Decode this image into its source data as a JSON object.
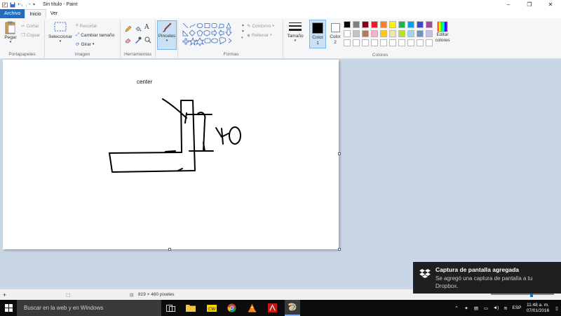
{
  "window": {
    "title": "Sin título - Paint",
    "controls": [
      "–",
      "❐",
      "✕"
    ]
  },
  "tabs": [
    "Archivo",
    "Inicio",
    "Ver"
  ],
  "ribbon": {
    "clipboard": {
      "paste": "Pegar",
      "cut": "Cortar",
      "copy": "Copiar",
      "label": "Portapapeles"
    },
    "image": {
      "select": "Seleccionar",
      "crop": "Recortar",
      "resize": "Cambiar tamaño",
      "rotate": "Girar",
      "label": "Imagen"
    },
    "tools": {
      "label": "Herramientas"
    },
    "brushes": {
      "label": "Pinceles"
    },
    "shapes": {
      "outline": "Contorno",
      "fill": "Rellenar",
      "label": "Formas"
    },
    "size": {
      "label": "Tamaño"
    },
    "color1": {
      "label": "Color 1",
      "value": "#000000"
    },
    "color2": {
      "label": "Color 2",
      "value": "#ffffff"
    },
    "colors_label": "Colores",
    "edit_colors": "Editar colores",
    "palette_row1": [
      "#000000",
      "#7f7f7f",
      "#880015",
      "#ed1c24",
      "#ff7f27",
      "#fff200",
      "#22b14c",
      "#00a2e8",
      "#3f48cc",
      "#a349a4"
    ],
    "palette_row2": [
      "#ffffff",
      "#c3c3c3",
      "#b97a57",
      "#ffaec9",
      "#ffc90e",
      "#efe4b0",
      "#b5e61d",
      "#99d9ea",
      "#7092be",
      "#c8bfe7"
    ],
    "palette_row3": [
      "#ffffff",
      "#ffffff",
      "#ffffff",
      "#ffffff",
      "#ffffff",
      "#ffffff",
      "#ffffff",
      "#ffffff",
      "#ffffff",
      "#ffffff"
    ]
  },
  "canvas": {
    "text": "center"
  },
  "statusbar": {
    "size": "819 × 460 píxeles"
  },
  "toast": {
    "title": "Captura de pantalla agregada",
    "body": "Se agregó una captura de pantalla a tu Dropbox."
  },
  "taskbar": {
    "search_placeholder": "Buscar en la web y en Windows",
    "time": "11:48 a. m.",
    "date": "07/01/2016",
    "language": "ESP"
  }
}
